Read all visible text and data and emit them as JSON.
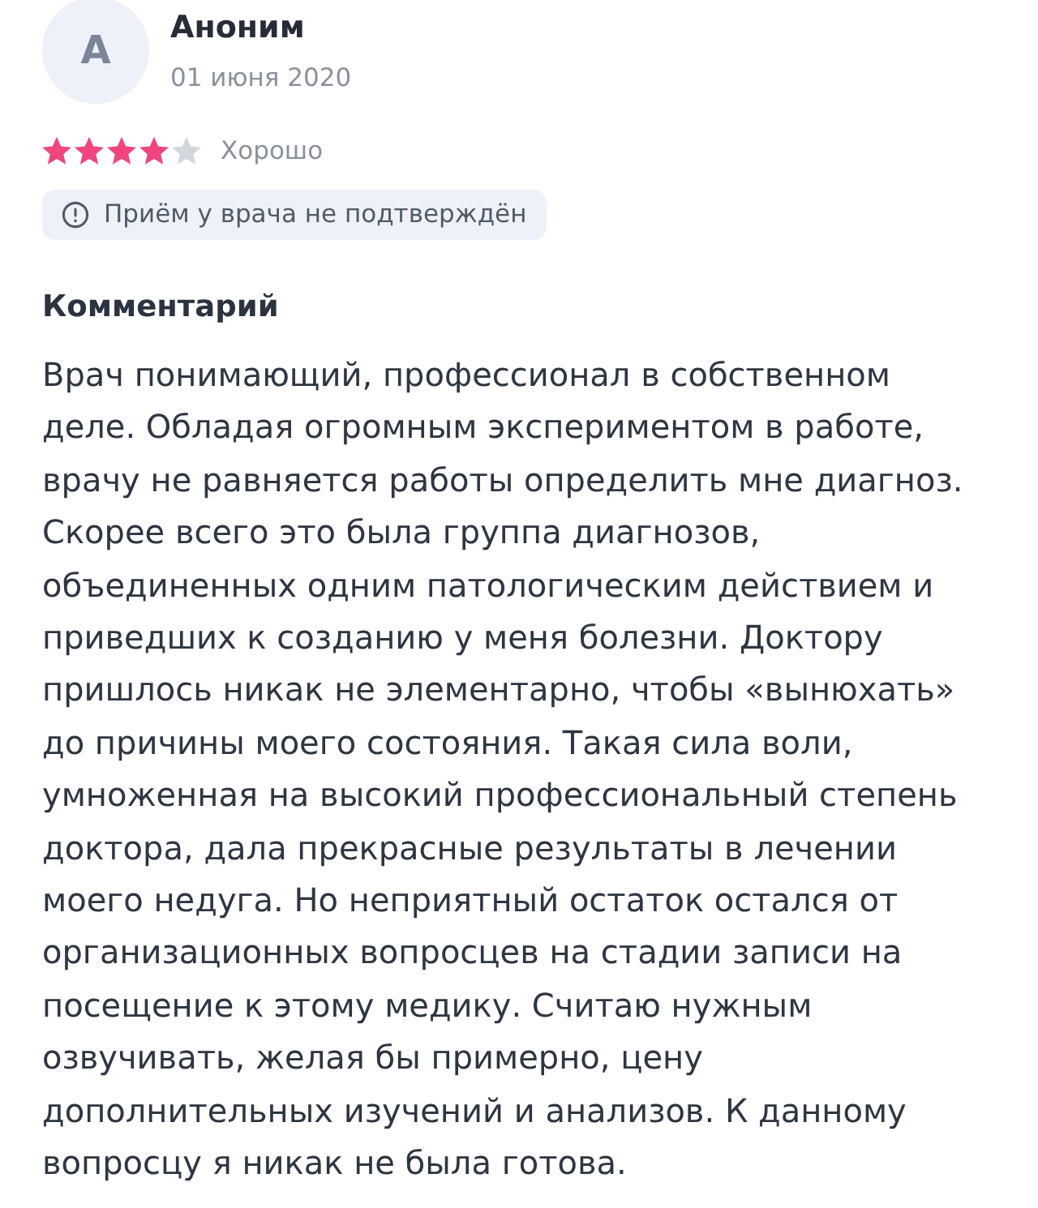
{
  "review": {
    "author": {
      "initial": "А",
      "name": "Аноним",
      "date": "01 июня 2020"
    },
    "rating": {
      "stars": 4,
      "label": "Хорошо"
    },
    "notice": {
      "text": "Приём у врача не подтверждён"
    }
  },
  "comment": {
    "heading": "Комментарий",
    "text": "Врач понимающий, профессионал в собственном деле. Обладая огромным экспериментом в работе, врачу не равняется работы определить мне диагноз. Скорее всего это была группа диагнозов, объединенных одним патологическим действием и приведших к созданию у меня болезни. Доктору пришлось никак не элементарно, чтобы «вынюхать» до причины моего состояния. Такая сила воли, умноженная на высокий профессиональный степень доктора, дала прекрасные результаты в лечении моего недуга. Но неприятный остаток остался от организационных вопросцев на стадии записи на посещение к этому медику. Считаю нужным озвучивать, желая бы примерно, цену дополнительных изучений и анализов. К данному вопросцу я никак не была готова."
  }
}
